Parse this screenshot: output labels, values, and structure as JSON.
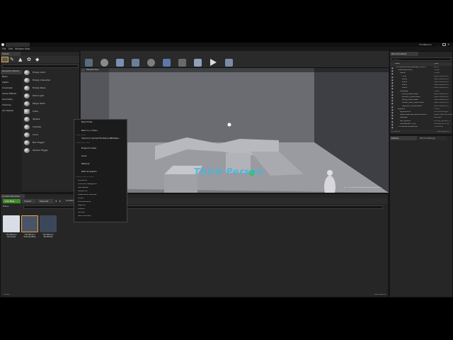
{
  "window": {
    "title": "ThirdPerson"
  },
  "menu": [
    "File",
    "Edit",
    "Window",
    "Help"
  ],
  "modes": {
    "tab": "Modes"
  },
  "place_categories": [
    "Recently Placed",
    "Basic",
    "Lights",
    "Cinematic",
    "Visual Effects",
    "Geometry",
    "Volumes",
    "All Classes"
  ],
  "place_items": [
    "Empty Actor",
    "Empty Character",
    "Empty Pawn",
    "Point Light",
    "Player Start",
    "Cube",
    "Sphere",
    "Cylinder",
    "Cone",
    "Box Trigger",
    "Sphere Trigger"
  ],
  "toolbar": [
    {
      "label": "Save Current",
      "icon": "save-icon"
    },
    {
      "label": "Source Control",
      "icon": "source-control-icon"
    },
    {
      "label": "Content",
      "icon": "content-icon"
    },
    {
      "label": "Marketplace",
      "icon": "marketplace-icon"
    },
    {
      "label": "Settings",
      "icon": "settings-icon"
    },
    {
      "label": "Blueprints",
      "icon": "blueprints-icon"
    },
    {
      "label": "Cinematics",
      "icon": "cinematics-icon"
    },
    {
      "label": "Build",
      "icon": "build-icon"
    },
    {
      "label": "Play",
      "icon": "play-icon"
    },
    {
      "label": "Launch",
      "icon": "launch-icon"
    }
  ],
  "viewport": {
    "view_mode": "Perspective",
    "stat_text": "LIT: ThirdPersonExampleMap (Persistent)",
    "floor_text": "Third Person"
  },
  "world_outliner": {
    "tab": "World Outliner",
    "search_placeholder": "Search...",
    "col_label": "Label",
    "col_type": "Type",
    "rows": [
      {
        "name": "ThirdPersonExampleMap (Editor)",
        "type": "World",
        "indent": 0
      },
      {
        "name": "ArenaGeometry",
        "type": "Folder",
        "indent": 1
      },
      {
        "name": "Arena",
        "type": "Folder",
        "indent": 2
      },
      {
        "name": "Floor",
        "type": "StaticMeshActor",
        "indent": 3
      },
      {
        "name": "Wall1",
        "type": "StaticMeshActor",
        "indent": 3
      },
      {
        "name": "Wall2",
        "type": "StaticMeshActor",
        "indent": 3
      },
      {
        "name": "Wall3",
        "type": "StaticMeshActor",
        "indent": 3
      },
      {
        "name": "Wall4",
        "type": "StaticMeshActor",
        "indent": 3
      },
      {
        "name": "Walkway",
        "type": "Folder",
        "indent": 2
      },
      {
        "name": "Bump_StaticMesh",
        "type": "StaticMeshActor",
        "indent": 3
      },
      {
        "name": "LeftArm_StaticMesh",
        "type": "StaticMeshActor",
        "indent": 3
      },
      {
        "name": "Ramp_StaticMesh",
        "type": "StaticMeshActor",
        "indent": 3
      },
      {
        "name": "Linear_Stair_StaticMesh",
        "type": "StaticMeshActor",
        "indent": 3
      },
      {
        "name": "RightArm_StaticMesh",
        "type": "StaticMeshActor",
        "indent": 3
      },
      {
        "name": "Lighting",
        "type": "Folder",
        "indent": 1
      },
      {
        "name": "LightSource",
        "type": "DirectionalLight",
        "indent": 2
      },
      {
        "name": "LightmassImportanceVolume",
        "type": "LightmassImportanceVolume",
        "indent": 2
      },
      {
        "name": "SkyLight",
        "type": "SkyLight",
        "indent": 2
      },
      {
        "name": "Sky Sphere",
        "type": "BP_Sky_Sphere_C",
        "indent": 2
      },
      {
        "name": "Atmospheric Fog",
        "type": "AtmosphericFog",
        "indent": 2
      },
      {
        "name": "ThirdPersonCharacter",
        "type": "Character",
        "indent": 1
      }
    ],
    "footer_count": "23 actors",
    "view_options": "View Options"
  },
  "details": {
    "tab": "Details",
    "world_settings_tab": "World Settings"
  },
  "content_browser": {
    "tab": "Content Browser",
    "add_new": "Add New",
    "import": "Import",
    "save_all": "Save All",
    "path": "Content",
    "filters": "Filters",
    "assets": [
      {
        "name": "ThirdPerson Overview"
      },
      {
        "name": "ThirdPerson ExampleMap"
      },
      {
        "name": "ThirdPerson BuildData"
      }
    ],
    "footer_count": "3 items",
    "view_options": "View Options"
  },
  "context_menu": {
    "top_items": [
      "New Folder",
      "New C++ Class..."
    ],
    "import_header": "Import Asset",
    "import_item": "Import to /Game/ThirdPersonBP/Maps...",
    "basic_header": "Create Basic Asset",
    "basic_items": [
      "Blueprint Class",
      "Level",
      "Material",
      "Particle System"
    ],
    "advanced_header": "Create Advanced Asset",
    "advanced_items": [
      "Animation",
      "Artificial Intelligence",
      "Blendables",
      "Blueprints",
      "Materials & Textures",
      "Media",
      "Miscellaneous",
      "Paper2D",
      "Physics",
      "Sounds",
      "User Interface"
    ]
  },
  "colors": {
    "accent": "#e8a23a",
    "play": "#5fbf3b",
    "add_new": "#3f8f2a",
    "selection": "#4a6ea0"
  }
}
